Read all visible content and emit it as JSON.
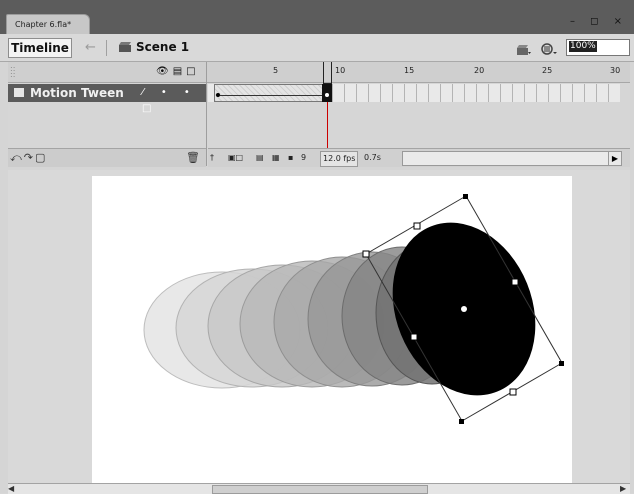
{
  "document": {
    "tab_title": "Chapter 6.fla*"
  },
  "scenebar": {
    "timeline_label": "Timeline",
    "scene_label": "Scene 1",
    "zoom_value": "100%"
  },
  "timeline": {
    "layer_name": "Motion Tween",
    "ruler_ticks": [
      "5",
      "10",
      "15",
      "20",
      "25",
      "30"
    ],
    "current_frame": "9",
    "frame_rate": "12.0 fps",
    "elapsed_time": "0.7s"
  },
  "stage": {
    "fill_color": "#000000",
    "ghost_colors": [
      "#e3e3e3",
      "#d2d2d2",
      "#c2c2c2",
      "#b2b2b2",
      "#a3a3a3",
      "#959595",
      "#878787",
      "#777777"
    ]
  }
}
